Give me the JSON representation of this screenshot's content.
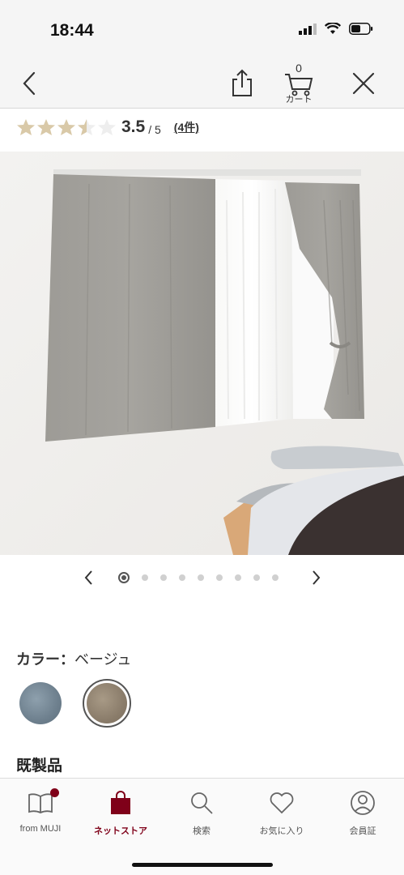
{
  "status": {
    "time": "18:44"
  },
  "nav": {
    "cart_count": "0",
    "cart_label": "カート"
  },
  "rating": {
    "value": "3.5",
    "max": "/ 5",
    "count": "(4件)",
    "stars": 3.5
  },
  "carousel": {
    "total": 9,
    "active_index": 0
  },
  "color": {
    "label": "カラー：",
    "value": "ベージュ"
  },
  "section": {
    "title": "既製品"
  },
  "tabs": [
    {
      "label": "from MUJI"
    },
    {
      "label": "ネットストア"
    },
    {
      "label": "検索"
    },
    {
      "label": "お気に入り"
    },
    {
      "label": "会員証"
    }
  ],
  "colors": {
    "accent": "#7f0019",
    "star": "#d9c9a8"
  }
}
